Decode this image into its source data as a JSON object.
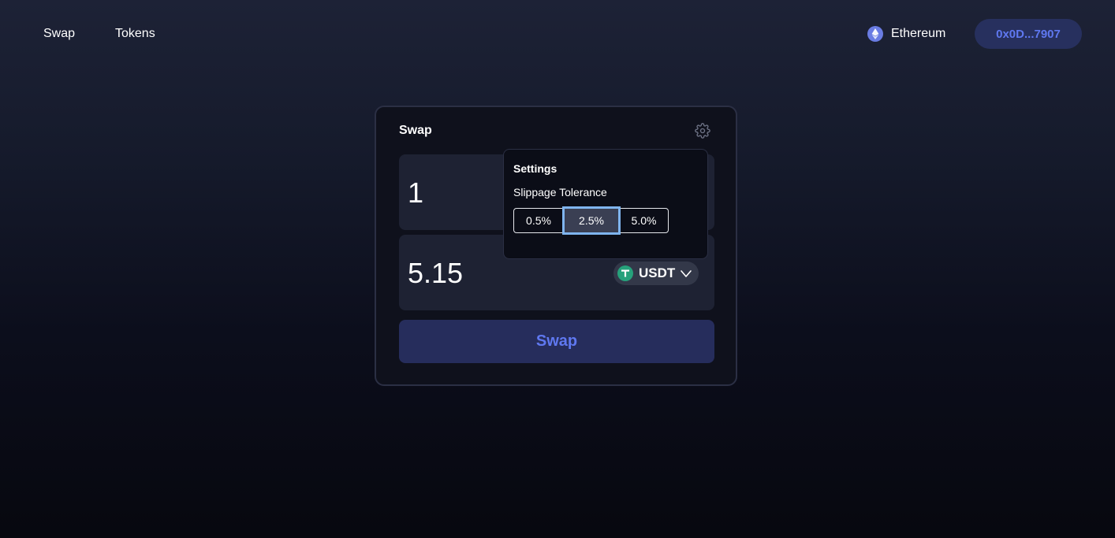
{
  "nav": {
    "links": [
      "Swap",
      "Tokens"
    ]
  },
  "network": {
    "label": "Ethereum",
    "icon": "ethereum-icon"
  },
  "wallet": {
    "address": "0x0D...7907"
  },
  "swap_card": {
    "title": "Swap",
    "settings_icon": "gear-icon",
    "from": {
      "amount": "1"
    },
    "to": {
      "amount": "5.15",
      "token": "USDT",
      "token_icon": "tether-icon"
    },
    "swap_button": "Swap"
  },
  "settings": {
    "title": "Settings",
    "slippage_label": "Slippage Tolerance",
    "options": [
      "0.5%",
      "2.5%",
      "5.0%"
    ],
    "selected": "2.5%"
  },
  "colors": {
    "accent": "#5f78f0",
    "button_bg": "#262d5c",
    "wallet_bg": "#27305e",
    "card_bg": "#0f111c",
    "input_bg": "#1e2233",
    "usdt_green": "#26a17b",
    "eth_purple": "#6a7ce3",
    "focus_ring": "#7fb4ee"
  }
}
